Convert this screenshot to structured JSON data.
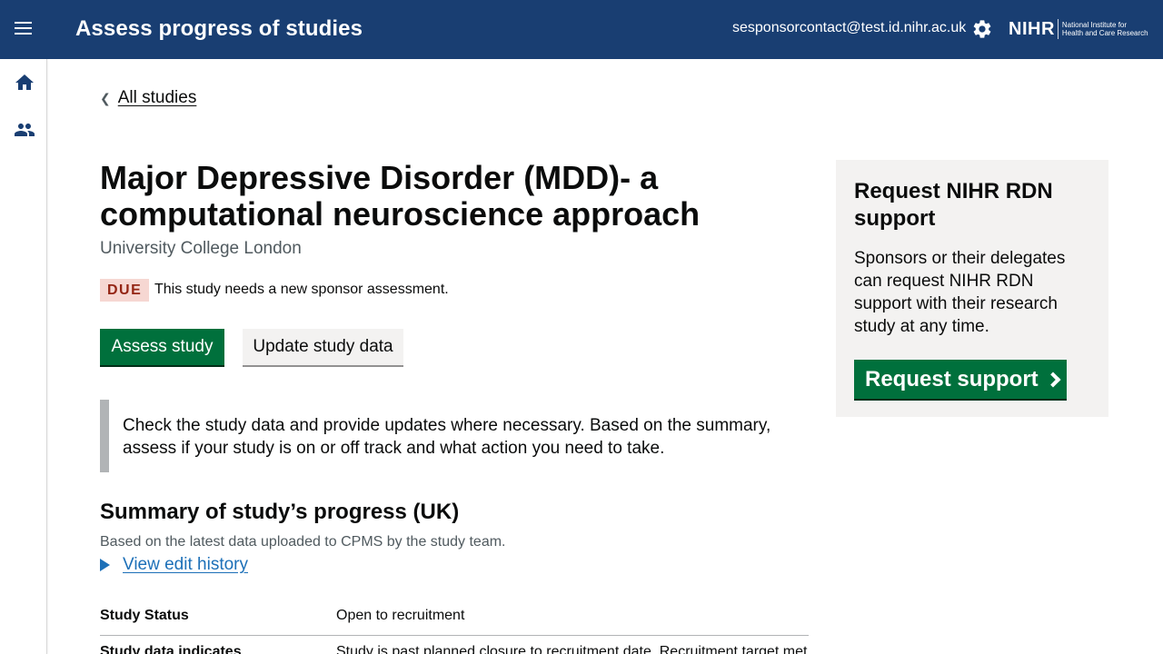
{
  "header": {
    "title": "Assess progress of studies",
    "user_email": "sesponsorcontact@test.id.nihr.ac.uk",
    "logo_main": "NIHR",
    "logo_sub_line1": "National Institute for",
    "logo_sub_line2": "Health and Care Research",
    "menu_icon": "hamburger-icon",
    "settings_icon": "gear-icon"
  },
  "sidebar": {
    "items": [
      {
        "icon": "home-icon"
      },
      {
        "icon": "users-icon"
      }
    ]
  },
  "breadcrumb": {
    "back_label": "All studies"
  },
  "study": {
    "title": "Major Depressive Disorder (MDD)- a computational neuroscience approach",
    "organisation": "University College London",
    "status_badge": "DUE",
    "status_text": "This study needs a new sponsor assessment."
  },
  "actions": {
    "assess_label": "Assess study",
    "update_label": "Update study data"
  },
  "inset": {
    "text": "Check the study data and provide updates where necessary. Based on the summary, assess if your study is on or off track and what action you need to take."
  },
  "summary": {
    "heading": "Summary of study’s progress (UK)",
    "subtext": "Based on the latest data uploaded to CPMS by the study team.",
    "details_label": "View edit history",
    "rows": [
      {
        "key": "Study Status",
        "value": "Open to recruitment"
      },
      {
        "key": "Study data indicates",
        "value": "Study is past planned closure to recruitment date. Recruitment target met"
      }
    ]
  },
  "panel": {
    "heading": "Request NIHR RDN support",
    "body": "Sponsors or their delegates can request NIHR RDN support with their research study at any time.",
    "button_label": "Request support"
  },
  "colors": {
    "header_bg": "#193e72",
    "primary_green": "#00703c",
    "link_blue": "#1d70b8",
    "due_bg": "#f6d7d2",
    "due_text": "#942514"
  }
}
